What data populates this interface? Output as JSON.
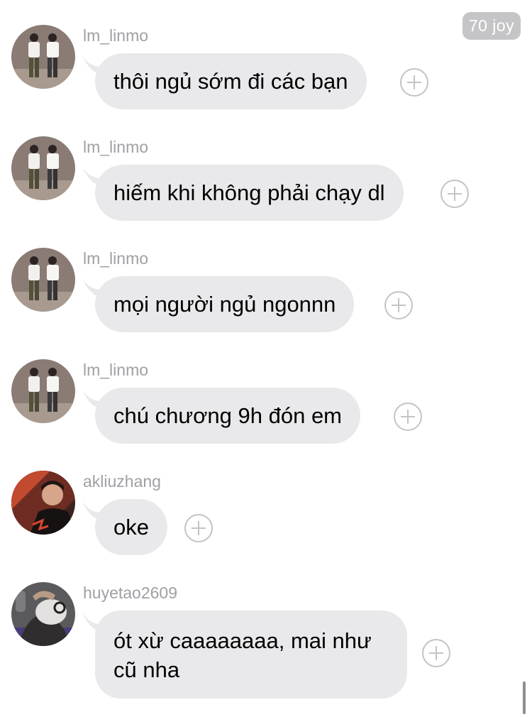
{
  "badge": {
    "label": "70 joy"
  },
  "messages": [
    {
      "username": "lm_linmo",
      "text": "thôi ngủ sớm đi các bạn",
      "avatar_icon": "dancing-duo-avatar"
    },
    {
      "username": "lm_linmo",
      "text": "hiếm khi không phải chạy dl",
      "avatar_icon": "dancing-duo-avatar"
    },
    {
      "username": "lm_linmo",
      "text": "mọi người ngủ ngonnn",
      "avatar_icon": "dancing-duo-avatar"
    },
    {
      "username": "lm_linmo",
      "text": "chú chương 9h đón em",
      "avatar_icon": "dancing-duo-avatar"
    },
    {
      "username": "akliuzhang",
      "text": "oke",
      "avatar_icon": "red-portrait-avatar"
    },
    {
      "username": "huyetao2609",
      "text": "ót xừ caaaaaaaa, mai như cũ nha",
      "avatar_icon": "masked-person-avatar"
    }
  ],
  "colors": {
    "bubble": "#e9e9eb",
    "username": "#a0a0a5",
    "badge": "#c5c5c7",
    "plus": "#c4c4c6"
  }
}
